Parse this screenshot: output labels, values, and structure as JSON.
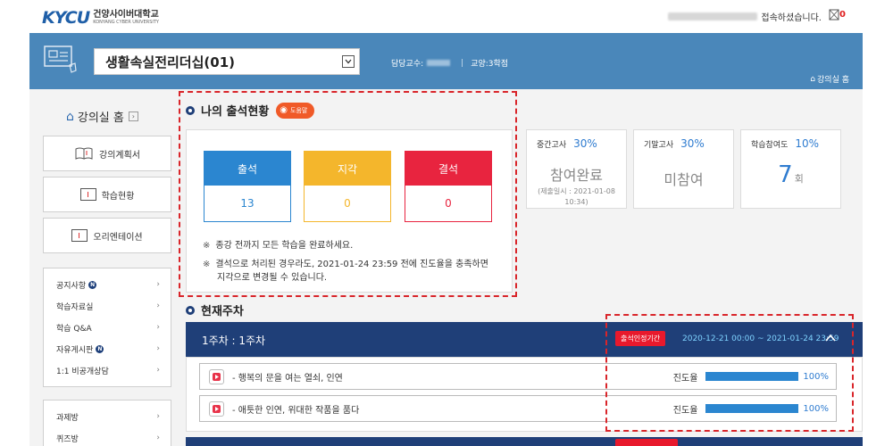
{
  "header": {
    "logo_mark": "KYCU",
    "logo_ko": "건양사이버대학교",
    "logo_en": "KONYANG CYBER UNIVERSITY",
    "welcome_suffix": "접속하셨습니다.",
    "mail_count": "0"
  },
  "course": {
    "selected": "생활속실전리더십(01)",
    "professor_label": "담당교수:",
    "category": "교양:3학점",
    "home_link": "강의실 홈"
  },
  "sidebar": {
    "home_label": "강의실 홈",
    "home_chevron": "›",
    "buttons": [
      {
        "label": "강의계획서"
      },
      {
        "label": "학습현황"
      },
      {
        "label": "오리엔테이션"
      }
    ],
    "board_items": [
      {
        "label": "공지사항",
        "new": "N"
      },
      {
        "label": "학습자료실",
        "new": ""
      },
      {
        "label": "학습 Q&A",
        "new": ""
      },
      {
        "label": "자유게시판",
        "new": "N"
      },
      {
        "label": "1:1 비공개상담",
        "new": ""
      }
    ],
    "task_items": [
      {
        "label": "과제방"
      },
      {
        "label": "퀴즈방"
      }
    ],
    "arrow": "›"
  },
  "attendance": {
    "title": "나의 출석현황",
    "help_label": "도움말",
    "cards": [
      {
        "label": "출석",
        "value": "13",
        "color": "#2b86d0"
      },
      {
        "label": "지각",
        "value": "0",
        "color": "#f4b62c"
      },
      {
        "label": "결석",
        "value": "0",
        "color": "#e8243f"
      }
    ],
    "note_mark": "※",
    "note1": "종강 전까지 모든 학습을 완료하세요.",
    "note2_line1": "결석으로 처리된 경우라도, 2021-01-24 23:59 전에 진도율을 충족하면",
    "note2_line2": "지각으로 변경될 수 있습니다."
  },
  "exams": {
    "midterm": {
      "label": "중간고사",
      "pct": "30%",
      "status": "참여완료",
      "sub": "(제출일시 : 2021-01-08 10:34)"
    },
    "final": {
      "label": "기말고사",
      "pct": "30%",
      "status": "미참여"
    },
    "participation": {
      "label": "학습참여도",
      "pct": "10%",
      "value": "7",
      "unit": "회"
    }
  },
  "current_week": {
    "title": "현재주차",
    "week_label": "1주차 : 1주차",
    "badge": "출석인정기간",
    "period": "2020-12-21 00:00 ~ 2021-01-24 23:59",
    "progress_label": "진도율",
    "lessons": [
      {
        "title": "- 행복의 문을 여는 열쇠, 인연",
        "progress": "100%"
      },
      {
        "title": "- 애틋한 인연, 위대한 작품을 품다",
        "progress": "100%"
      }
    ]
  },
  "colors": {
    "header_bg": "#4a87ba",
    "navy": "#1f3f78",
    "accent_red": "#e8192c",
    "progress_blue": "#2b86d0",
    "help_orange": "#f05a28"
  }
}
